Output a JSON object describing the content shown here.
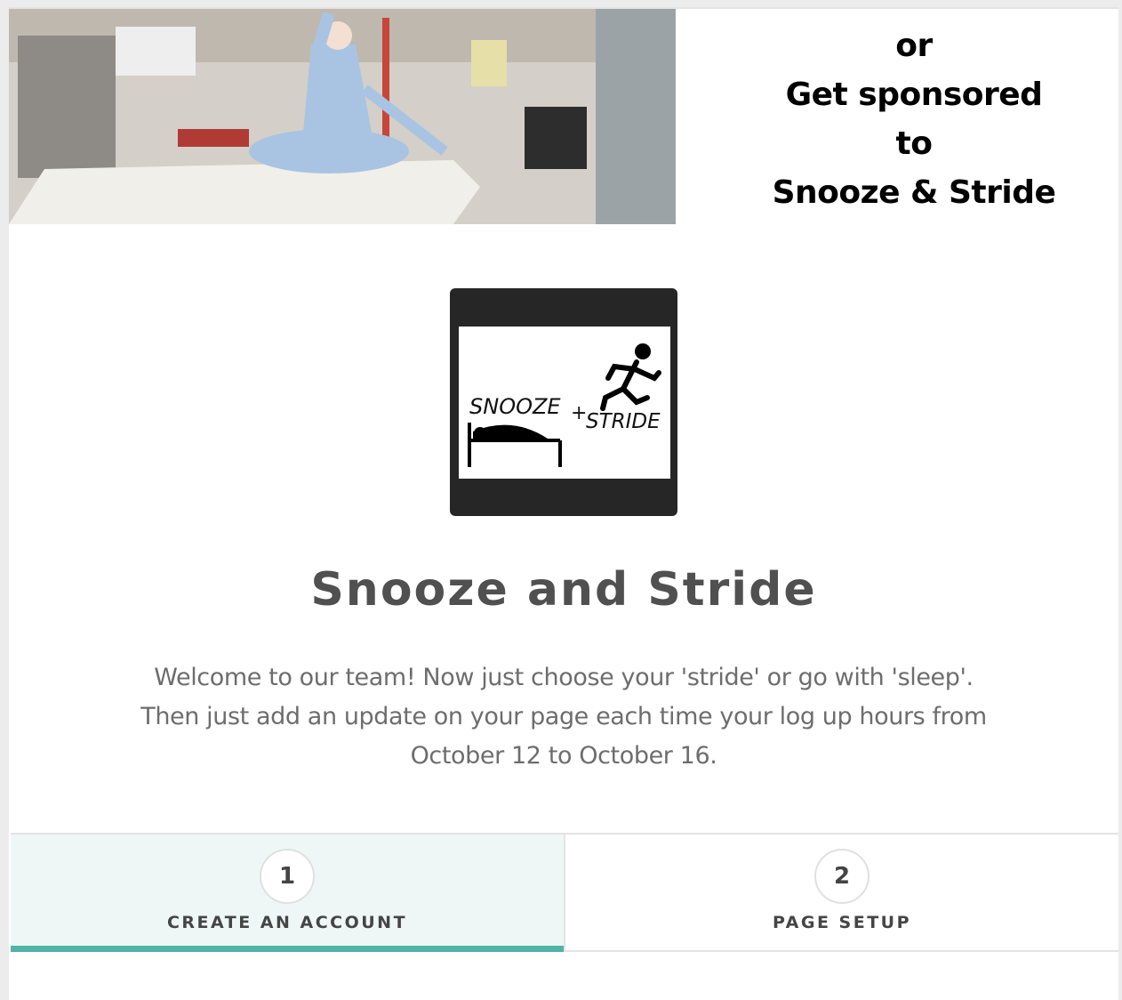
{
  "banner": {
    "lines": [
      "or",
      "Get sponsored",
      "to",
      "Snooze & Stride"
    ]
  },
  "logo": {
    "word_left": "SNOOZE",
    "plus": "+",
    "word_right": "STRIDE"
  },
  "page": {
    "title": "Snooze and Stride",
    "welcome_lines": [
      "Welcome to our team! Now just choose your 'stride' or go with 'sleep'.",
      "Then just add an update on your page each time your log up hours from",
      "October 12 to October 16."
    ]
  },
  "steps": [
    {
      "number": "1",
      "label": "CREATE AN ACCOUNT",
      "active": true
    },
    {
      "number": "2",
      "label": "PAGE SETUP",
      "active": false
    }
  ],
  "colors": {
    "accent": "#52b3a7",
    "active_tab_bg": "#eef7f5",
    "title": "#505050"
  }
}
